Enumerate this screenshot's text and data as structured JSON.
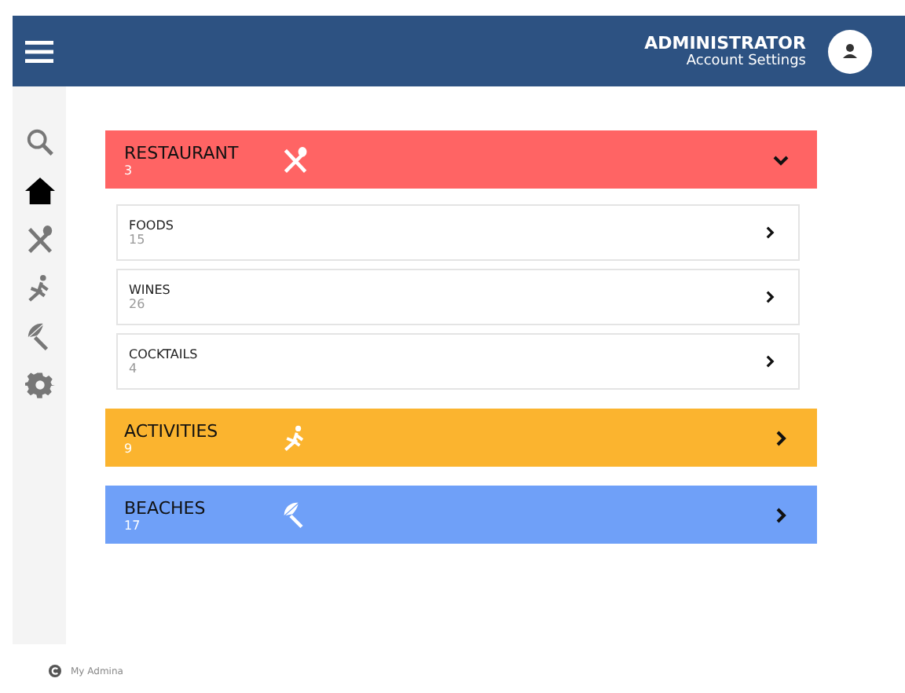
{
  "header": {
    "user": "ADMINISTRATOR",
    "subtitle": "Account Settings"
  },
  "sidebar": {
    "items": [
      {
        "kind": "search",
        "selected": false
      },
      {
        "kind": "home",
        "selected": true
      },
      {
        "kind": "dining",
        "selected": false
      },
      {
        "kind": "activity",
        "selected": false
      },
      {
        "kind": "beach",
        "selected": false
      },
      {
        "kind": "settings",
        "selected": false
      }
    ]
  },
  "categories": [
    {
      "kind": "dining",
      "title": "RESTAURANT",
      "count": "3",
      "color": "#ff6464",
      "expanded": true,
      "children": [
        {
          "title": "FOODS",
          "count": "15"
        },
        {
          "title": "WINES",
          "count": "26"
        },
        {
          "title": "COCKTAILS",
          "count": "4"
        }
      ]
    },
    {
      "kind": "activity",
      "title": "ACTIVITIES",
      "count": "9",
      "color": "#fbb42f",
      "expanded": false
    },
    {
      "kind": "beach",
      "title": "BEACHES",
      "count": "17",
      "color": "#6fa0f8",
      "expanded": false
    }
  ],
  "footer": {
    "text": "My Admina"
  }
}
